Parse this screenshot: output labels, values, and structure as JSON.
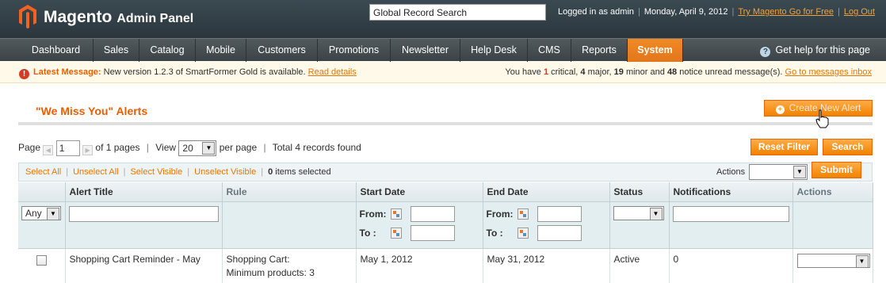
{
  "header": {
    "brand": "Magento",
    "brand_sub": "Admin Panel",
    "search_value": "Global Record Search",
    "logged_in": "Logged in as admin",
    "date": "Monday, April 9, 2012",
    "try_link": "Try Magento Go for Free",
    "logout": "Log Out"
  },
  "nav": {
    "items": [
      "Dashboard",
      "Sales",
      "Catalog",
      "Mobile",
      "Customers",
      "Promotions",
      "Newsletter",
      "Help Desk",
      "CMS",
      "Reports",
      "System"
    ],
    "active": "System",
    "help": "Get help for this page"
  },
  "message": {
    "label": "Latest Message:",
    "text": "New version 1.2.3 of SmartFormer Gold is available.",
    "link": "Read details",
    "summary_prefix": "You have",
    "critical_count": "1",
    "critical_label": "critical,",
    "major_count": "4",
    "major_label": "major,",
    "minor_count": "19",
    "minor_label": "minor and",
    "notice_count": "48",
    "notice_label": "notice unread message(s).",
    "inbox_link": "Go to messages inbox"
  },
  "page": {
    "title": "\"We Miss You\" Alerts",
    "create_button": "Create New Alert"
  },
  "pager": {
    "page_label": "Page",
    "page_value": "1",
    "of_pages": "of 1 pages",
    "view_label": "View",
    "per_page_value": "20",
    "per_page_label": "per page",
    "total": "Total 4 records found",
    "reset_button": "Reset Filter",
    "search_button": "Search"
  },
  "massaction": {
    "select_all": "Select All",
    "unselect_all": "Unselect All",
    "select_visible": "Select Visible",
    "unselect_visible": "Unselect Visible",
    "selected_count": "0",
    "selected_label": "items selected",
    "actions_label": "Actions",
    "submit": "Submit"
  },
  "grid": {
    "columns": [
      "",
      "Alert Title",
      "Rule",
      "Start Date",
      "End Date",
      "Status",
      "Notifications",
      "Actions"
    ],
    "filter_any": "Any",
    "from_label": "From:",
    "to_label": "To :",
    "rows": [
      {
        "title": "Shopping Cart Reminder - May",
        "rule_line1": "Shopping Cart:",
        "rule_line2": "Minimum products: 3",
        "start": "May 1, 2012",
        "end": "May 31, 2012",
        "status": "Active",
        "notifications": "0"
      }
    ]
  },
  "colors": {
    "accent": "#eb5e00",
    "button": "#f18200",
    "header": "#2f3b41"
  }
}
